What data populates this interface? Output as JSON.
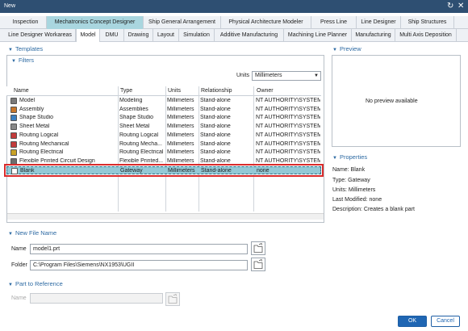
{
  "window": {
    "title": "New",
    "restore_icon": "↻",
    "close_icon": "✕"
  },
  "tabs_row1": [
    {
      "label": "Inspection"
    },
    {
      "label": "Mechatronics Concept Designer"
    },
    {
      "label": "Ship General Arrangement"
    },
    {
      "label": "Physical Architecture Modeler"
    },
    {
      "label": "Press Line"
    },
    {
      "label": "Line Designer"
    },
    {
      "label": "Ship Structures"
    }
  ],
  "tabs_row2": [
    {
      "label": "Line Designer Workareas"
    },
    {
      "label": "Model"
    },
    {
      "label": "DMU"
    },
    {
      "label": "Drawing"
    },
    {
      "label": "Layout"
    },
    {
      "label": "Simulation"
    },
    {
      "label": "Additive Manufacturing"
    },
    {
      "label": "Machining Line Planner"
    },
    {
      "label": "Manufacturing"
    },
    {
      "label": "Multi Axis Deposition"
    }
  ],
  "templates": {
    "title": "Templates",
    "filters_title": "Filters",
    "units_label": "Units",
    "units_value": "Millimeters",
    "columns": [
      "Name",
      "Type",
      "Units",
      "Relationship",
      "Owner"
    ],
    "rows": [
      {
        "name": "Model",
        "type": "Modeling",
        "units": "Millimeters",
        "relationship": "Stand-alone",
        "owner": "NT AUTHORITY\\SYSTEM",
        "icon": "model-icon"
      },
      {
        "name": "Assembly",
        "type": "Assemblies",
        "units": "Millimeters",
        "relationship": "Stand-alone",
        "owner": "NT AUTHORITY\\SYSTEM",
        "icon": "assembly-icon"
      },
      {
        "name": "Shape Studio",
        "type": "Shape Studio",
        "units": "Millimeters",
        "relationship": "Stand-alone",
        "owner": "NT AUTHORITY\\SYSTEM",
        "icon": "shape-studio-icon"
      },
      {
        "name": "Sheet Metal",
        "type": "Sheet Metal",
        "units": "Millimeters",
        "relationship": "Stand-alone",
        "owner": "NT AUTHORITY\\SYSTEM",
        "icon": "sheet-metal-icon"
      },
      {
        "name": "Routing Logical",
        "type": "Routing Logical",
        "units": "Millimeters",
        "relationship": "Stand-alone",
        "owner": "NT AUTHORITY\\SYSTEM",
        "icon": "routing-logical-icon"
      },
      {
        "name": "Routing Mechanical",
        "type": "Routing Mecha...",
        "units": "Millimeters",
        "relationship": "Stand-alone",
        "owner": "NT AUTHORITY\\SYSTEM",
        "icon": "routing-mechanical-icon"
      },
      {
        "name": "Routing Electrical",
        "type": "Routing Electrical",
        "units": "Millimeters",
        "relationship": "Stand-alone",
        "owner": "NT AUTHORITY\\SYSTEM",
        "icon": "routing-electrical-icon"
      },
      {
        "name": "Flexible Printed Circuit Design",
        "type": "Flexible Printed...",
        "units": "Millimeters",
        "relationship": "Stand-alone",
        "owner": "NT AUTHORITY\\SYSTEM",
        "icon": "flex-circuit-icon"
      },
      {
        "name": "Blank",
        "type": "Gateway",
        "units": "Millimeters",
        "relationship": "Stand-alone",
        "owner": "none",
        "icon": "blank-icon"
      }
    ]
  },
  "new_file": {
    "title": "New File Name",
    "name_label": "Name",
    "name_value": "model1.prt",
    "folder_label": "Folder",
    "folder_value": "C:\\Program Files\\Siemens\\NX1953\\UGII"
  },
  "part_ref": {
    "title": "Part to Reference",
    "name_label": "Name"
  },
  "preview": {
    "title": "Preview",
    "text": "No preview available"
  },
  "properties": {
    "title": "Properties",
    "name": "Name: Blank",
    "type": "Type: Gateway",
    "units": "Units: Millimeters",
    "last_modified": "Last Modified: none",
    "description": "Description: Creates a blank part"
  },
  "buttons": {
    "ok": "OK",
    "cancel": "Cancel"
  },
  "colors": {
    "titlebar": "#2e4f72",
    "accent": "#1f66b3",
    "selected_tab": "#a9d6df",
    "selected_row": "#93c9d6",
    "highlight": "#d92b2b"
  }
}
